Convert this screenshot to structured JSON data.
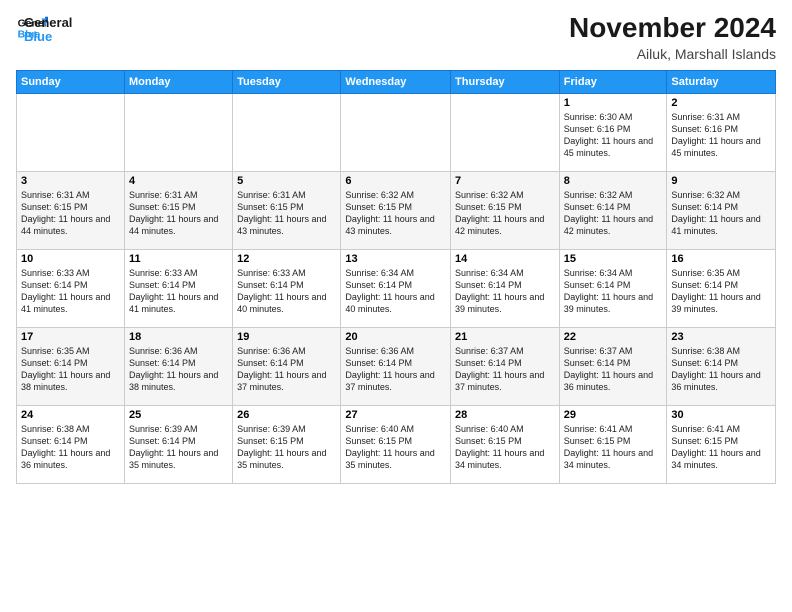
{
  "logo": {
    "line1": "General",
    "line2": "Blue"
  },
  "header": {
    "month": "November 2024",
    "location": "Ailuk, Marshall Islands"
  },
  "weekdays": [
    "Sunday",
    "Monday",
    "Tuesday",
    "Wednesday",
    "Thursday",
    "Friday",
    "Saturday"
  ],
  "weeks": [
    [
      {
        "day": "",
        "info": ""
      },
      {
        "day": "",
        "info": ""
      },
      {
        "day": "",
        "info": ""
      },
      {
        "day": "",
        "info": ""
      },
      {
        "day": "",
        "info": ""
      },
      {
        "day": "1",
        "info": "Sunrise: 6:30 AM\nSunset: 6:16 PM\nDaylight: 11 hours and 45 minutes."
      },
      {
        "day": "2",
        "info": "Sunrise: 6:31 AM\nSunset: 6:16 PM\nDaylight: 11 hours and 45 minutes."
      }
    ],
    [
      {
        "day": "3",
        "info": "Sunrise: 6:31 AM\nSunset: 6:15 PM\nDaylight: 11 hours and 44 minutes."
      },
      {
        "day": "4",
        "info": "Sunrise: 6:31 AM\nSunset: 6:15 PM\nDaylight: 11 hours and 44 minutes."
      },
      {
        "day": "5",
        "info": "Sunrise: 6:31 AM\nSunset: 6:15 PM\nDaylight: 11 hours and 43 minutes."
      },
      {
        "day": "6",
        "info": "Sunrise: 6:32 AM\nSunset: 6:15 PM\nDaylight: 11 hours and 43 minutes."
      },
      {
        "day": "7",
        "info": "Sunrise: 6:32 AM\nSunset: 6:15 PM\nDaylight: 11 hours and 42 minutes."
      },
      {
        "day": "8",
        "info": "Sunrise: 6:32 AM\nSunset: 6:14 PM\nDaylight: 11 hours and 42 minutes."
      },
      {
        "day": "9",
        "info": "Sunrise: 6:32 AM\nSunset: 6:14 PM\nDaylight: 11 hours and 41 minutes."
      }
    ],
    [
      {
        "day": "10",
        "info": "Sunrise: 6:33 AM\nSunset: 6:14 PM\nDaylight: 11 hours and 41 minutes."
      },
      {
        "day": "11",
        "info": "Sunrise: 6:33 AM\nSunset: 6:14 PM\nDaylight: 11 hours and 41 minutes."
      },
      {
        "day": "12",
        "info": "Sunrise: 6:33 AM\nSunset: 6:14 PM\nDaylight: 11 hours and 40 minutes."
      },
      {
        "day": "13",
        "info": "Sunrise: 6:34 AM\nSunset: 6:14 PM\nDaylight: 11 hours and 40 minutes."
      },
      {
        "day": "14",
        "info": "Sunrise: 6:34 AM\nSunset: 6:14 PM\nDaylight: 11 hours and 39 minutes."
      },
      {
        "day": "15",
        "info": "Sunrise: 6:34 AM\nSunset: 6:14 PM\nDaylight: 11 hours and 39 minutes."
      },
      {
        "day": "16",
        "info": "Sunrise: 6:35 AM\nSunset: 6:14 PM\nDaylight: 11 hours and 39 minutes."
      }
    ],
    [
      {
        "day": "17",
        "info": "Sunrise: 6:35 AM\nSunset: 6:14 PM\nDaylight: 11 hours and 38 minutes."
      },
      {
        "day": "18",
        "info": "Sunrise: 6:36 AM\nSunset: 6:14 PM\nDaylight: 11 hours and 38 minutes."
      },
      {
        "day": "19",
        "info": "Sunrise: 6:36 AM\nSunset: 6:14 PM\nDaylight: 11 hours and 37 minutes."
      },
      {
        "day": "20",
        "info": "Sunrise: 6:36 AM\nSunset: 6:14 PM\nDaylight: 11 hours and 37 minutes."
      },
      {
        "day": "21",
        "info": "Sunrise: 6:37 AM\nSunset: 6:14 PM\nDaylight: 11 hours and 37 minutes."
      },
      {
        "day": "22",
        "info": "Sunrise: 6:37 AM\nSunset: 6:14 PM\nDaylight: 11 hours and 36 minutes."
      },
      {
        "day": "23",
        "info": "Sunrise: 6:38 AM\nSunset: 6:14 PM\nDaylight: 11 hours and 36 minutes."
      }
    ],
    [
      {
        "day": "24",
        "info": "Sunrise: 6:38 AM\nSunset: 6:14 PM\nDaylight: 11 hours and 36 minutes."
      },
      {
        "day": "25",
        "info": "Sunrise: 6:39 AM\nSunset: 6:14 PM\nDaylight: 11 hours and 35 minutes."
      },
      {
        "day": "26",
        "info": "Sunrise: 6:39 AM\nSunset: 6:15 PM\nDaylight: 11 hours and 35 minutes."
      },
      {
        "day": "27",
        "info": "Sunrise: 6:40 AM\nSunset: 6:15 PM\nDaylight: 11 hours and 35 minutes."
      },
      {
        "day": "28",
        "info": "Sunrise: 6:40 AM\nSunset: 6:15 PM\nDaylight: 11 hours and 34 minutes."
      },
      {
        "day": "29",
        "info": "Sunrise: 6:41 AM\nSunset: 6:15 PM\nDaylight: 11 hours and 34 minutes."
      },
      {
        "day": "30",
        "info": "Sunrise: 6:41 AM\nSunset: 6:15 PM\nDaylight: 11 hours and 34 minutes."
      }
    ]
  ]
}
